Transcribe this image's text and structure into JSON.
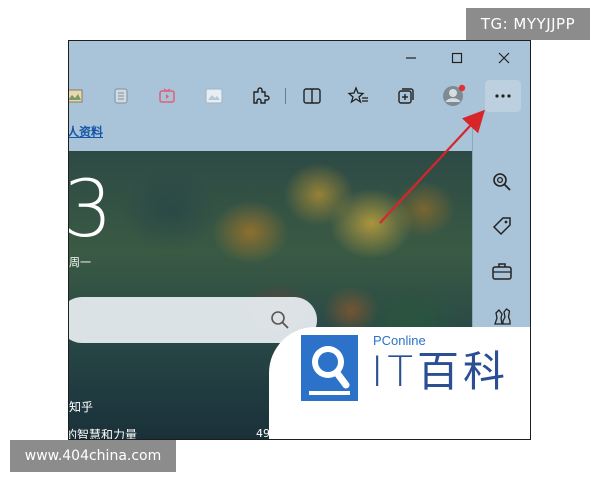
{
  "watermarks": {
    "top": "TG: MYYJJPP",
    "bottom": "www.404china.com"
  },
  "titlebar": {
    "minimize": "minimize",
    "maximize": "maximize",
    "close": "close"
  },
  "toolbar": {
    "icons": [
      "image-icon",
      "reading-icon",
      "video-icon",
      "photo-icon",
      "extensions-icon",
      "split-screen-icon",
      "favorites-icon",
      "collections-icon",
      "profile-icon",
      "more-icon"
    ],
    "more_label": "···"
  },
  "favorites_bar": {
    "link": "人资料"
  },
  "new_tab": {
    "day": "3",
    "weekday": "周一",
    "news": [
      {
        "title": "知乎"
      },
      {
        "title": "的智慧和力量",
        "count": "49"
      }
    ]
  },
  "sidebar": {
    "icons": [
      "search-icon",
      "tag-icon",
      "briefcase-icon",
      "chess-icon",
      "bing-icon",
      "office-icon"
    ]
  },
  "logo": {
    "brand": "PConline",
    "name": "IT百科"
  },
  "colors": {
    "chrome": "#a9c4d8",
    "arrow": "#d7252a",
    "logo_blue": "#2c72c9"
  }
}
